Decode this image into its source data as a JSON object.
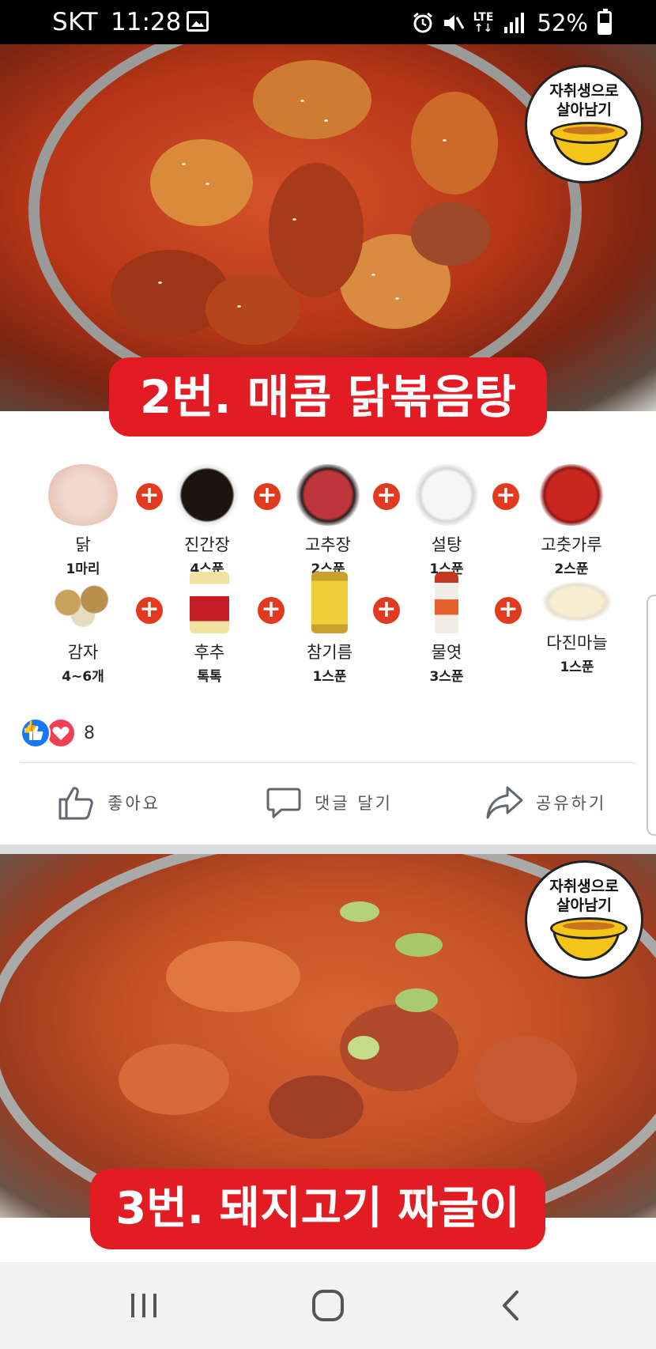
{
  "status_bar": {
    "carrier": "SKT",
    "time": "11:28",
    "network": "LTE",
    "battery_percent": "52%",
    "battery_level": 0.52,
    "icons": [
      "image-icon",
      "alarm-icon",
      "mute-icon",
      "lte-icon",
      "signal-icon",
      "battery-icon"
    ]
  },
  "post1": {
    "logo_text_line1": "자취생으로",
    "logo_text_line2": "살아남기",
    "title": "2번. 매콤 닭볶음탕",
    "ingredients_row1": [
      {
        "name": "닭",
        "amount": "1마리",
        "icon": "chicken-icon"
      },
      {
        "name": "진간장",
        "amount": "4스푼",
        "icon": "soy-sauce-icon"
      },
      {
        "name": "고추장",
        "amount": "2스푼",
        "icon": "gochujang-icon"
      },
      {
        "name": "설탕",
        "amount": "1스푼",
        "icon": "sugar-icon"
      },
      {
        "name": "고춧가루",
        "amount": "2스푼",
        "icon": "chili-powder-icon"
      }
    ],
    "ingredients_row2": [
      {
        "name": "감자",
        "amount": "4~6개",
        "icon": "potato-icon"
      },
      {
        "name": "후추",
        "amount": "톡톡",
        "icon": "pepper-icon"
      },
      {
        "name": "참기름",
        "amount": "1스푼",
        "icon": "sesame-oil-icon"
      },
      {
        "name": "물엿",
        "amount": "3스푼",
        "icon": "corn-syrup-icon"
      },
      {
        "name": "다진마늘",
        "amount": "1스푼",
        "icon": "garlic-icon"
      }
    ],
    "reaction_count": "8",
    "actions": {
      "like": "좋아요",
      "comment": "댓글 달기",
      "share": "공유하기"
    }
  },
  "post2": {
    "logo_text_line1": "자취생으로",
    "logo_text_line2": "살아남기",
    "title": "3번. 돼지고기 짜글이"
  },
  "colors": {
    "title_red": "#e31c24",
    "plus_orange": "#e23a1e",
    "like_blue": "#1877f2",
    "love_red": "#f33e58"
  }
}
